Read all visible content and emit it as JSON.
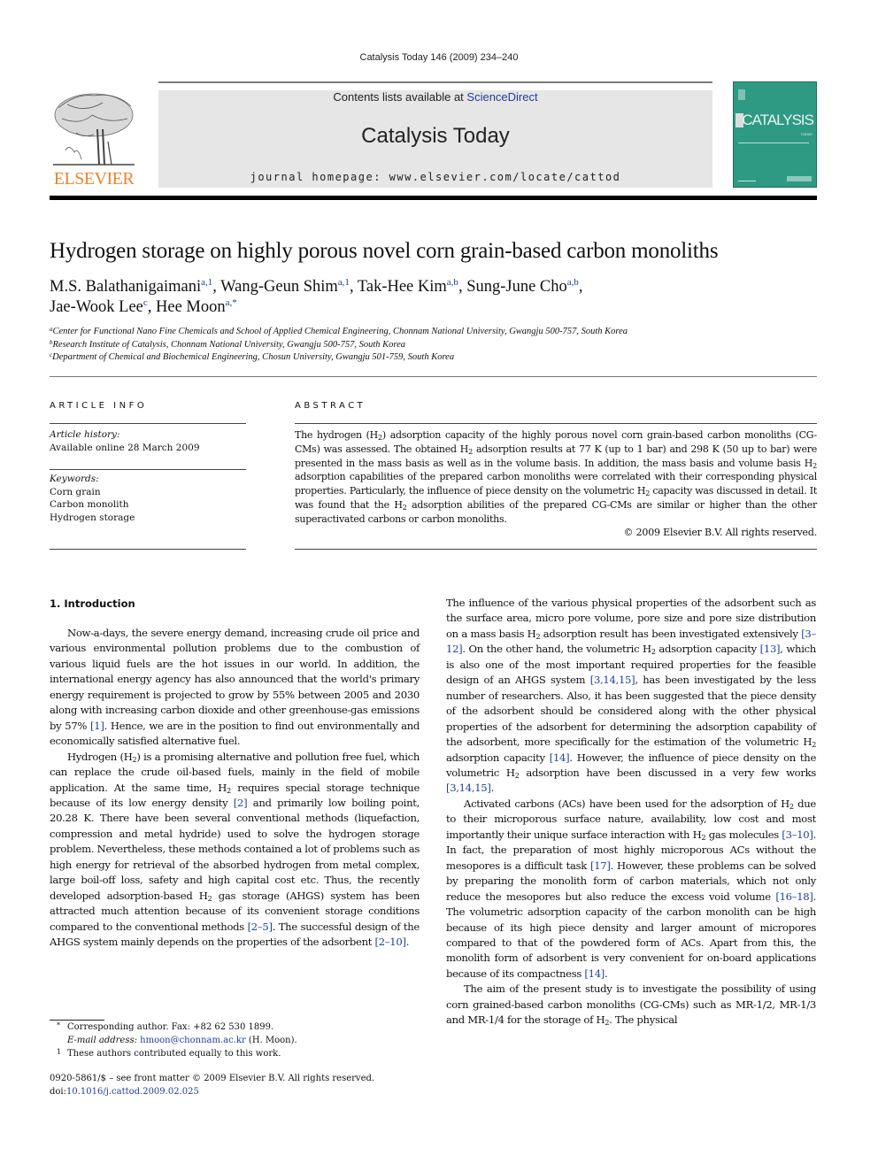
{
  "header": {
    "running_head": "Catalysis Today 146 (2009) 234–240",
    "publisher_logo_text": "ELSEVIER",
    "contents_prefix": "Contents lists available at ",
    "contents_link": "ScienceDirect",
    "journal_title": "Catalysis Today",
    "homepage": "journal homepage: www.elsevier.com/locate/cattod",
    "cover_title": "CATALYSIS",
    "cover_subtitle": "TODAY",
    "colors": {
      "elsevier_orange": "#f0822a",
      "link_blue": "#1d3f9a",
      "banner_gray": "#e6e6e6",
      "cover_teal": "#2e9a84"
    }
  },
  "article": {
    "title": "Hydrogen storage on highly porous novel corn grain-based carbon monoliths",
    "authors": [
      {
        "name": "M.S. Balathanigaimani",
        "sup": "a,1"
      },
      {
        "name": "Wang-Geun Shim",
        "sup": "a,1"
      },
      {
        "name": "Tak-Hee Kim",
        "sup": "a,b"
      },
      {
        "name": "Sung-June Cho",
        "sup": "a,b"
      },
      {
        "name": "Jae-Wook Lee",
        "sup": "c"
      },
      {
        "name": "Hee Moon",
        "sup": "a,*"
      }
    ],
    "affiliations": [
      {
        "mark": "a",
        "text": "Center for Functional Nano Fine Chemicals and School of Applied Chemical Engineering, Chonnam National University, Gwangju 500-757, South Korea"
      },
      {
        "mark": "b",
        "text": "Research Institute of Catalysis, Chonnam National University, Gwangju 500-757, South Korea"
      },
      {
        "mark": "c",
        "text": "Department of Chemical and Biochemical Engineering, Chosun University, Gwangju 501-759, South Korea"
      }
    ]
  },
  "article_info": {
    "heading": "ARTICLE INFO",
    "history_label": "Article history:",
    "history_value": "Available online 28 March 2009",
    "keywords_label": "Keywords:",
    "keywords": [
      "Corn grain",
      "Carbon monolith",
      "Hydrogen storage"
    ]
  },
  "abstract": {
    "heading": "ABSTRACT",
    "segments": {
      "s1": "The hydrogen (H",
      "s2": ") adsorption capacity of the highly porous novel corn grain-based carbon monoliths (CG-CMs) was assessed. The obtained H",
      "s3": " adsorption results at 77 K (up to 1 bar) and 298 K (50 up to bar) were presented in the mass basis as well as in the volume basis. In addition, the mass basis and volume basis H",
      "s4": " adsorption capabilities of the prepared carbon monoliths were correlated with their corresponding physical properties. Particularly, the influence of piece density on the volumetric H",
      "s5": " capacity was discussed in detail. It was found that the H",
      "s6": " adsorption abilities of the prepared CG-CMs are similar or higher than the other superactivated carbons or carbon monoliths."
    },
    "subscript": "2",
    "copyright": "© 2009 Elsevier B.V. All rights reserved."
  },
  "body": {
    "section_heading": "1.  Introduction",
    "left": {
      "p1": {
        "a": "Now-a-days, the severe energy demand, increasing crude oil price and various environmental pollution problems due to the combustion of various liquid fuels are the hot issues in our world. In addition, the international energy agency has also announced that the world's primary energy requirement is projected to grow by 55% between 2005 and 2030 along with increasing carbon dioxide and other greenhouse-gas emissions by 57% ",
        "ref1": "[1]",
        "b": ". Hence, we are in the position to find out environmentally and economically satisfied alternative fuel."
      },
      "p2": {
        "a": "Hydrogen (H",
        "b": ") is a promising alternative and pollution free fuel, which can replace the crude oil-based fuels, mainly in the field of mobile application. At the same time, H",
        "c": " requires special storage technique because of its low energy density ",
        "ref1": "[2]",
        "d": " and primarily low boiling point, 20.28 K. There have been several conventional methods (liquefaction, compression and metal hydride) used to solve the hydrogen storage problem. Nevertheless, these methods contained a lot of problems such as high energy for retrieval of the absorbed hydrogen from metal complex, large boil-off loss, safety and high capital cost etc. Thus, the recently developed adsorption-based H",
        "e": " gas storage (AHGS) system has been attracted much attention because of its convenient storage conditions compared to the conventional methods ",
        "ref2": "[2–5]",
        "f": ". The successful design of the AHGS system mainly depends on the properties of the adsorbent ",
        "ref3": "[2–10]",
        "g": "."
      }
    },
    "right": {
      "p1": {
        "a": "The influence of the various physical properties of the adsorbent such as the surface area, micro pore volume, pore size and pore size distribution on a mass basis H",
        "b": " adsorption result has been investigated extensively ",
        "ref1": "[3–12]",
        "c": ". On the other hand, the volumetric H",
        "d": " adsorption capacity ",
        "ref2": "[13]",
        "e": ", which is also one of the most important required properties for the feasible design of an AHGS system ",
        "ref3": "[3,14,15]",
        "f": ", has been investigated by the less number of researchers. Also, it has been suggested that the piece density of the adsorbent should be considered along with the other physical properties of the adsorbent for determining the adsorption capability of the adsorbent, more specifically for the estimation of the volumetric H",
        "g": " adsorption capacity ",
        "ref4": "[14]",
        "h": ". However, the influence of piece density on the volumetric H",
        "i": " adsorption have been discussed in a very few works ",
        "ref5": "[3,14,15]",
        "j": "."
      },
      "p2": {
        "a": "Activated carbons (ACs) have been used for the adsorption of H",
        "b": " due to their microporous surface nature, availability, low cost and most importantly their unique surface interaction with H",
        "c": " gas molecules ",
        "ref1": "[3–10]",
        "d": ". In fact, the preparation of most highly microporous ACs without the mesopores is a difficult task ",
        "ref2": "[17]",
        "e": ". However, these problems can be solved by preparing the monolith form of carbon materials, which not only reduce the mesopores but also reduce the excess void volume ",
        "ref3": "[16–18]",
        "f": ". The volumetric adsorption capacity of the carbon monolith can be high because of its high piece density and larger amount of micropores compared to that of the powdered form of ACs. Apart from this, the monolith form of adsorbent is very convenient for on-board applications because of its compactness ",
        "ref4": "[14]",
        "g": "."
      },
      "p3": {
        "a": "The aim of the present study is to investigate the possibility of using corn grained-based carbon monoliths (CG-CMs) such as MR-1/2, MR-1/3 and MR-1/4 for the storage of H",
        "b": ". The physical"
      }
    },
    "subscript": "2"
  },
  "footnotes": {
    "corresponding_mark": "*",
    "corresponding": "Corresponding author. Fax: +82 62 530 1899.",
    "email_label": "E-mail address:",
    "email": "hmoon@chonnam.ac.kr",
    "email_suffix": " (H. Moon).",
    "equal_mark": "1",
    "equal": "These authors contributed equally to this work."
  },
  "issn": {
    "line1": "0920-5861/$ – see front matter © 2009 Elsevier B.V. All rights reserved.",
    "doi_prefix": "doi:",
    "doi": "10.1016/j.cattod.2009.02.025"
  }
}
